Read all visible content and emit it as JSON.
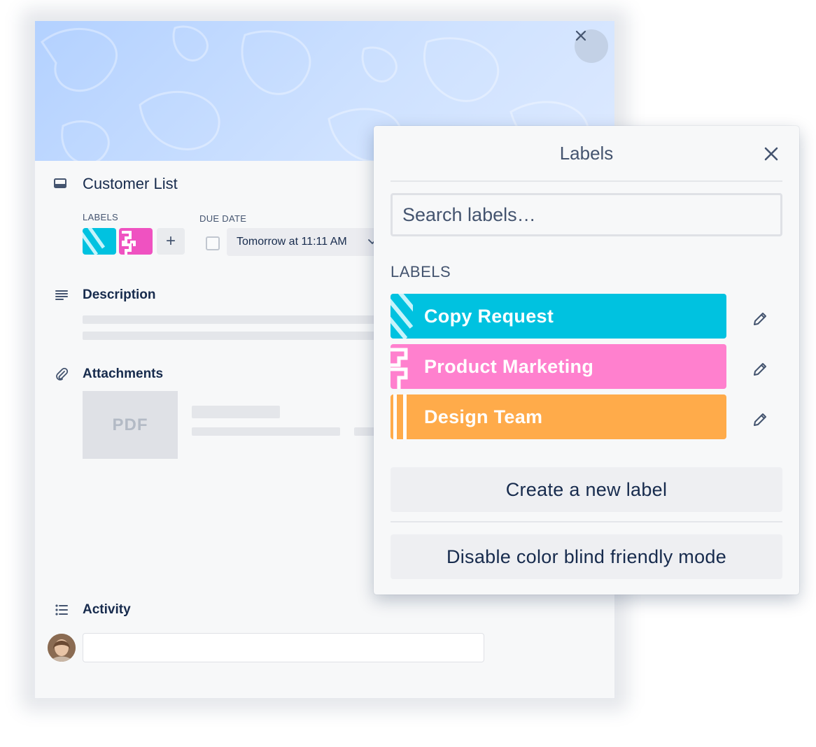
{
  "card": {
    "title": "Customer List",
    "labels_heading": "LABELS",
    "due_heading": "DUE DATE",
    "add_label_glyph": "+",
    "due_date_value": "Tomorrow at 11:11 AM",
    "description_heading": "Description",
    "attachments_heading": "Attachments",
    "attachment_thumb_text": "PDF",
    "activity_heading": "Activity",
    "applied_labels": [
      {
        "color": "#00c2e0",
        "pattern": "stripes"
      },
      {
        "color": "#ef52c1",
        "pattern": "blocks"
      }
    ],
    "icons": [
      "card-icon",
      "description-icon",
      "attachment-icon",
      "activity-icon",
      "close-icon",
      "chevron-down-icon"
    ]
  },
  "popover": {
    "title": "Labels",
    "search_placeholder": "Search labels…",
    "section_heading": "LABELS",
    "labels": [
      {
        "name": "Copy Request",
        "color": "#00c2e0",
        "pattern": "stripes"
      },
      {
        "name": "Product Marketing",
        "color": "#ff80ce",
        "pattern": "blocks"
      },
      {
        "name": "Design Team",
        "color": "#ffab4a",
        "pattern": "bars"
      }
    ],
    "create_label": "Create a new label",
    "colorblind_toggle": "Disable color blind friendly mode"
  },
  "colors": {
    "text_primary": "#172b4d",
    "text_subtle": "#44546f",
    "cover_blue": "#b3d1ff",
    "button_bg": "#eeeff2"
  }
}
